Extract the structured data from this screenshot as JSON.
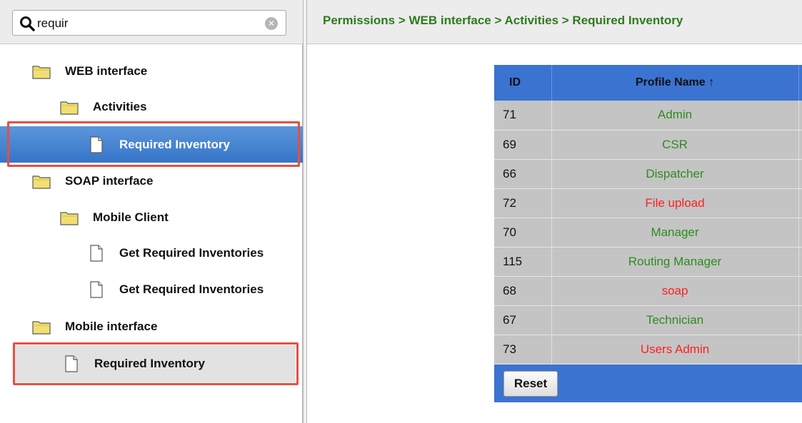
{
  "search": {
    "value": "requir"
  },
  "tree": {
    "items": [
      {
        "label": "WEB interface"
      },
      {
        "label": "Activities"
      },
      {
        "label": "Required Inventory"
      },
      {
        "label": "SOAP interface"
      },
      {
        "label": "Mobile Client"
      },
      {
        "label": "Get Required Inventories"
      },
      {
        "label": "Get Required Inventories"
      },
      {
        "label": "Mobile interface"
      },
      {
        "label": "Required Inventory"
      }
    ]
  },
  "breadcrumb": {
    "text": "Permissions  > WEB interface > Activities > Required Inventory"
  },
  "table": {
    "headers": {
      "id": "ID",
      "name": "Profile Name ↑"
    },
    "rows": [
      {
        "id": "71",
        "name": "Admin",
        "color": "#2e8b1e"
      },
      {
        "id": "69",
        "name": "CSR",
        "color": "#2e8b1e"
      },
      {
        "id": "66",
        "name": "Dispatcher",
        "color": "#2e8b1e"
      },
      {
        "id": "72",
        "name": "File upload",
        "color": "#ff1f1f"
      },
      {
        "id": "70",
        "name": "Manager",
        "color": "#2e8b1e"
      },
      {
        "id": "115",
        "name": "Routing Manager",
        "color": "#2e8b1e"
      },
      {
        "id": "68",
        "name": "soap",
        "color": "#ff1f1f"
      },
      {
        "id": "67",
        "name": "Technician",
        "color": "#2e8b1e"
      },
      {
        "id": "73",
        "name": "Users Admin",
        "color": "#ff1f1f"
      }
    ],
    "reset_label": "Reset"
  },
  "colors": {
    "accent": "#3b73d0",
    "selection": "#3575c8",
    "highlight_outline": "#e84f3f",
    "breadcrumb": "#2f7a1f"
  },
  "icons": {
    "search": "magnifier-icon",
    "clear": "clear-icon",
    "folder": "folder-icon",
    "document": "document-icon"
  }
}
